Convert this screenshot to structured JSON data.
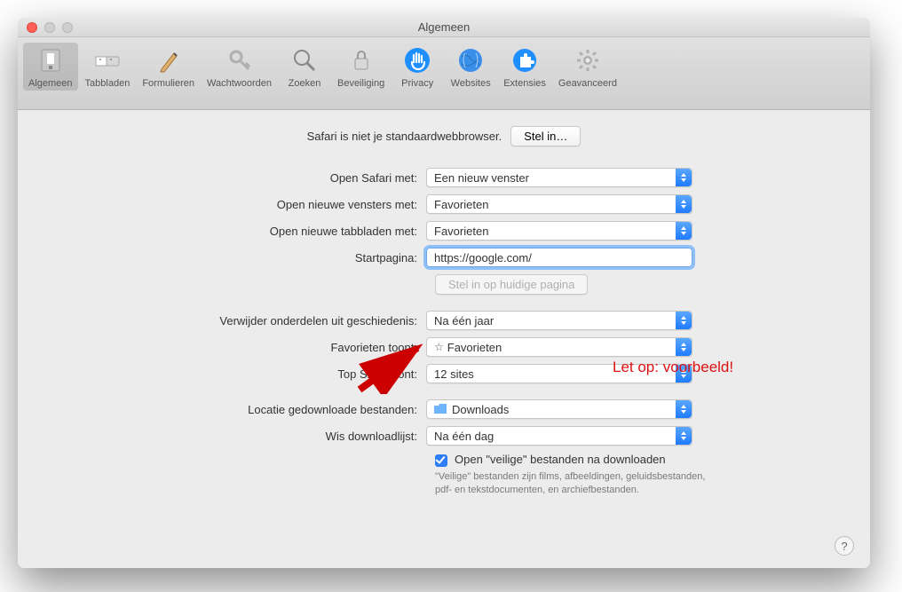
{
  "window": {
    "title": "Algemeen"
  },
  "toolbar": {
    "items": [
      {
        "id": "general",
        "label": "Algemeen"
      },
      {
        "id": "tabs",
        "label": "Tabbladen"
      },
      {
        "id": "autofill",
        "label": "Formulieren"
      },
      {
        "id": "passwords",
        "label": "Wachtwoorden"
      },
      {
        "id": "search",
        "label": "Zoeken"
      },
      {
        "id": "security",
        "label": "Beveiliging"
      },
      {
        "id": "privacy",
        "label": "Privacy"
      },
      {
        "id": "websites",
        "label": "Websites"
      },
      {
        "id": "extensions",
        "label": "Extensies"
      },
      {
        "id": "advanced",
        "label": "Geavanceerd"
      }
    ]
  },
  "default_browser": {
    "message": "Safari is niet je standaardwebbrowser.",
    "button": "Stel in…"
  },
  "rows": {
    "open_safari_with": {
      "label": "Open Safari met:",
      "value": "Een nieuw venster"
    },
    "open_new_windows": {
      "label": "Open nieuwe vensters met:",
      "value": "Favorieten"
    },
    "open_new_tabs": {
      "label": "Open nieuwe tabbladen met:",
      "value": "Favorieten"
    },
    "homepage": {
      "label": "Startpagina:",
      "value": "https://google.com/"
    },
    "set_current": {
      "button": "Stel in op huidige pagina"
    },
    "remove_history": {
      "label": "Verwijder onderdelen uit geschiedenis:",
      "value": "Na één jaar"
    },
    "favorites_shows": {
      "label": "Favorieten toont:",
      "value": "Favorieten"
    },
    "topsites_shows": {
      "label": "Top Sites toont:",
      "value": "12 sites"
    },
    "download_location": {
      "label": "Locatie gedownloade bestanden:",
      "value": "Downloads"
    },
    "clear_downloads": {
      "label": "Wis downloadlijst:",
      "value": "Na één dag"
    },
    "open_safe": {
      "label": "Open \"veilige\" bestanden na downloaden",
      "help": "\"Veilige\" bestanden zijn films, afbeeldingen, geluidsbestanden, pdf- en tekstdocumenten, en archiefbestanden."
    }
  },
  "annotation": {
    "text": "Let op: voorbeeld!"
  },
  "help_button": "?"
}
